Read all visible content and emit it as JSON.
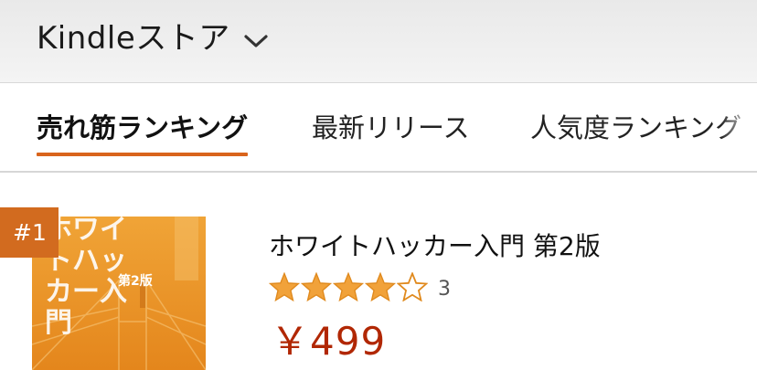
{
  "header": {
    "store_title": "Kindleストア"
  },
  "tabs": [
    {
      "label": "売れ筋ランキング",
      "active": true
    },
    {
      "label": "最新リリース",
      "active": false
    },
    {
      "label": "人気度ランキング",
      "active": false
    }
  ],
  "items": [
    {
      "rank": "#1",
      "title": "ホワイトハッカー入門 第2版",
      "rating": 4,
      "rating_max": 5,
      "review_count": "3",
      "price": "￥499",
      "cover": {
        "title_text": "ホワイトハッカー入門",
        "edition_text": "第2版"
      }
    }
  ],
  "colors": {
    "accent": "#d9641c",
    "badge": "#d26b1f",
    "price": "#b12704",
    "star": "#f1a23a"
  },
  "icons": {
    "dropdown": "chevron-down-icon",
    "star_full": "star-icon",
    "star_empty": "star-outline-icon"
  }
}
